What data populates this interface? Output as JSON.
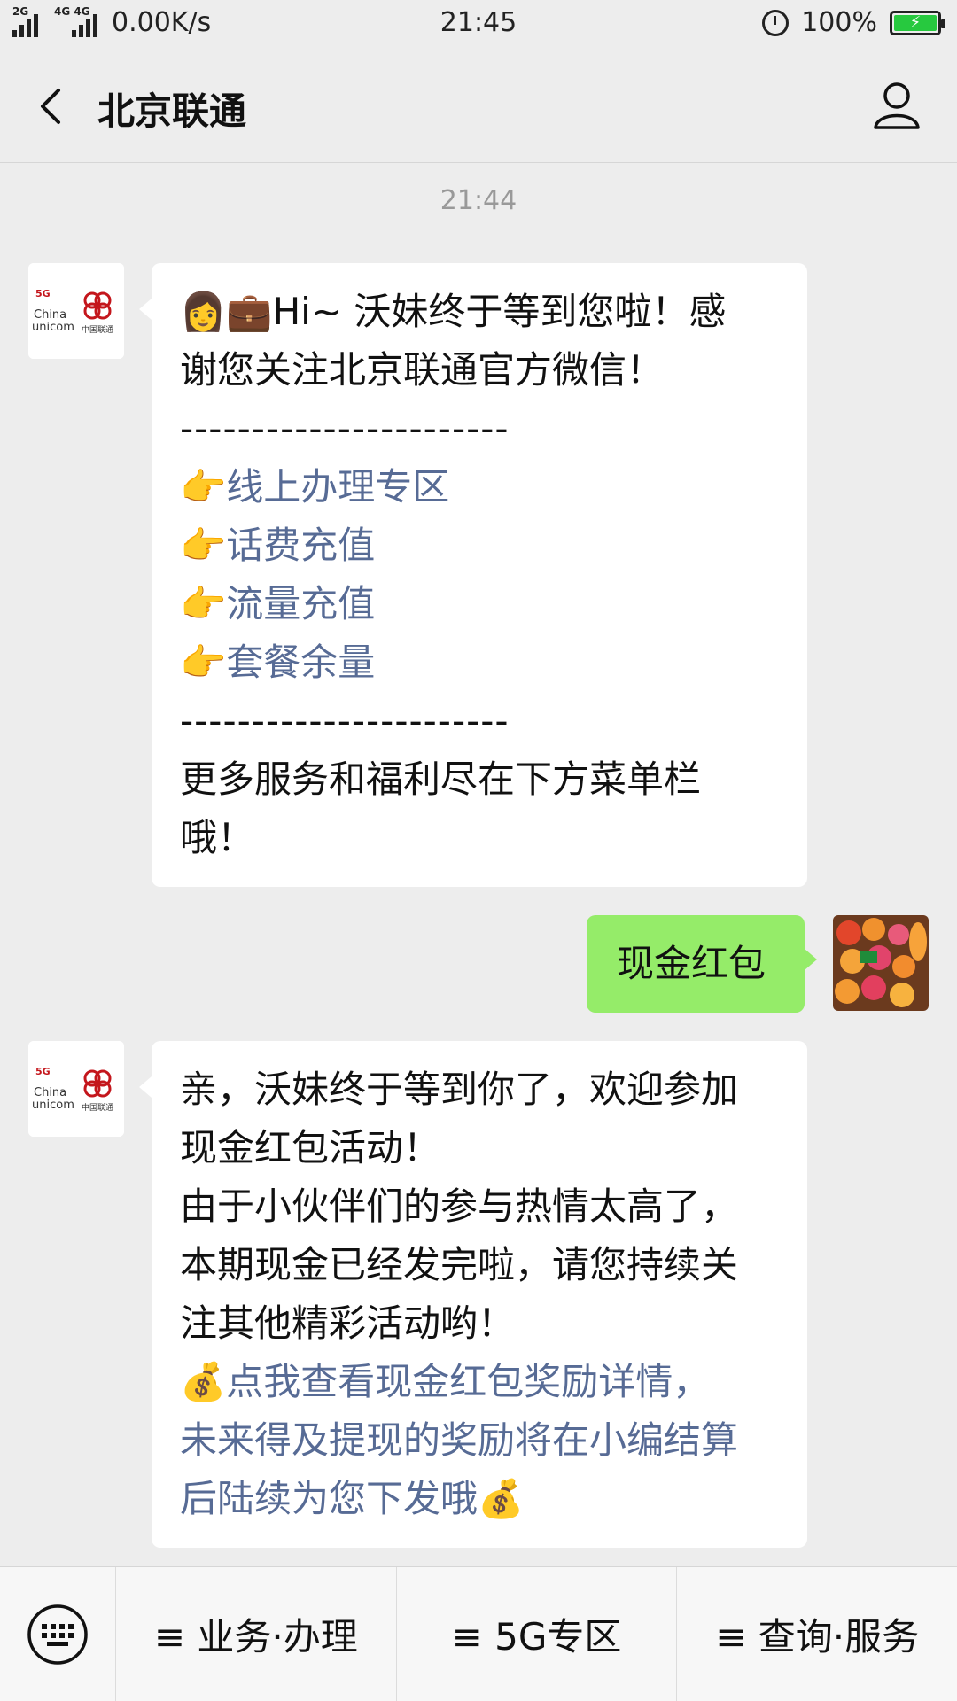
{
  "status_bar": {
    "sig1_label": "2G",
    "sig2_label": "4G 4G",
    "speed": "0.00K/s",
    "time": "21:45",
    "battery": "100%"
  },
  "nav": {
    "title": "北京联通",
    "back_icon": "chevron-left-icon",
    "profile_icon": "person-icon"
  },
  "chat": {
    "timestamp": "21:44",
    "messages": [
      {
        "from": "北京联通",
        "line1": "Hi~ 沃妹终于等到您啦！感",
        "line2": "谢您关注北京联通官方微信！",
        "emoji1": "👩",
        "emoji2": "💼",
        "divider": "-----------------------",
        "links": [
          "线上办理专区",
          "话费充值",
          "流量充值",
          "套餐余量"
        ],
        "point_emoji": "👉",
        "footer1": "更多服务和福利尽在下方菜单栏",
        "footer2": "哦！"
      },
      {
        "from": "me",
        "text": "现金红包"
      },
      {
        "from": "北京联通",
        "line1": "亲，沃妹终于等到你了，欢迎参加",
        "line2": "现金红包活动！",
        "line3": "由于小伙伴们的参与热情太高了，",
        "line4": "本期现金已经发完啦，请您持续关",
        "line5": "注其他精彩活动哟！",
        "money_emoji": "💰",
        "link1": "点我查看现金红包奖励详情，",
        "link2": "未来得及提现的奖励将在小编结算",
        "link3": "后陆续为您下发哦"
      }
    ]
  },
  "menu": {
    "keyboard_icon": "keyboard-icon",
    "items": [
      "≡ 业务·办理",
      "≡ 5G专区",
      "≡ 查询·服务"
    ]
  }
}
